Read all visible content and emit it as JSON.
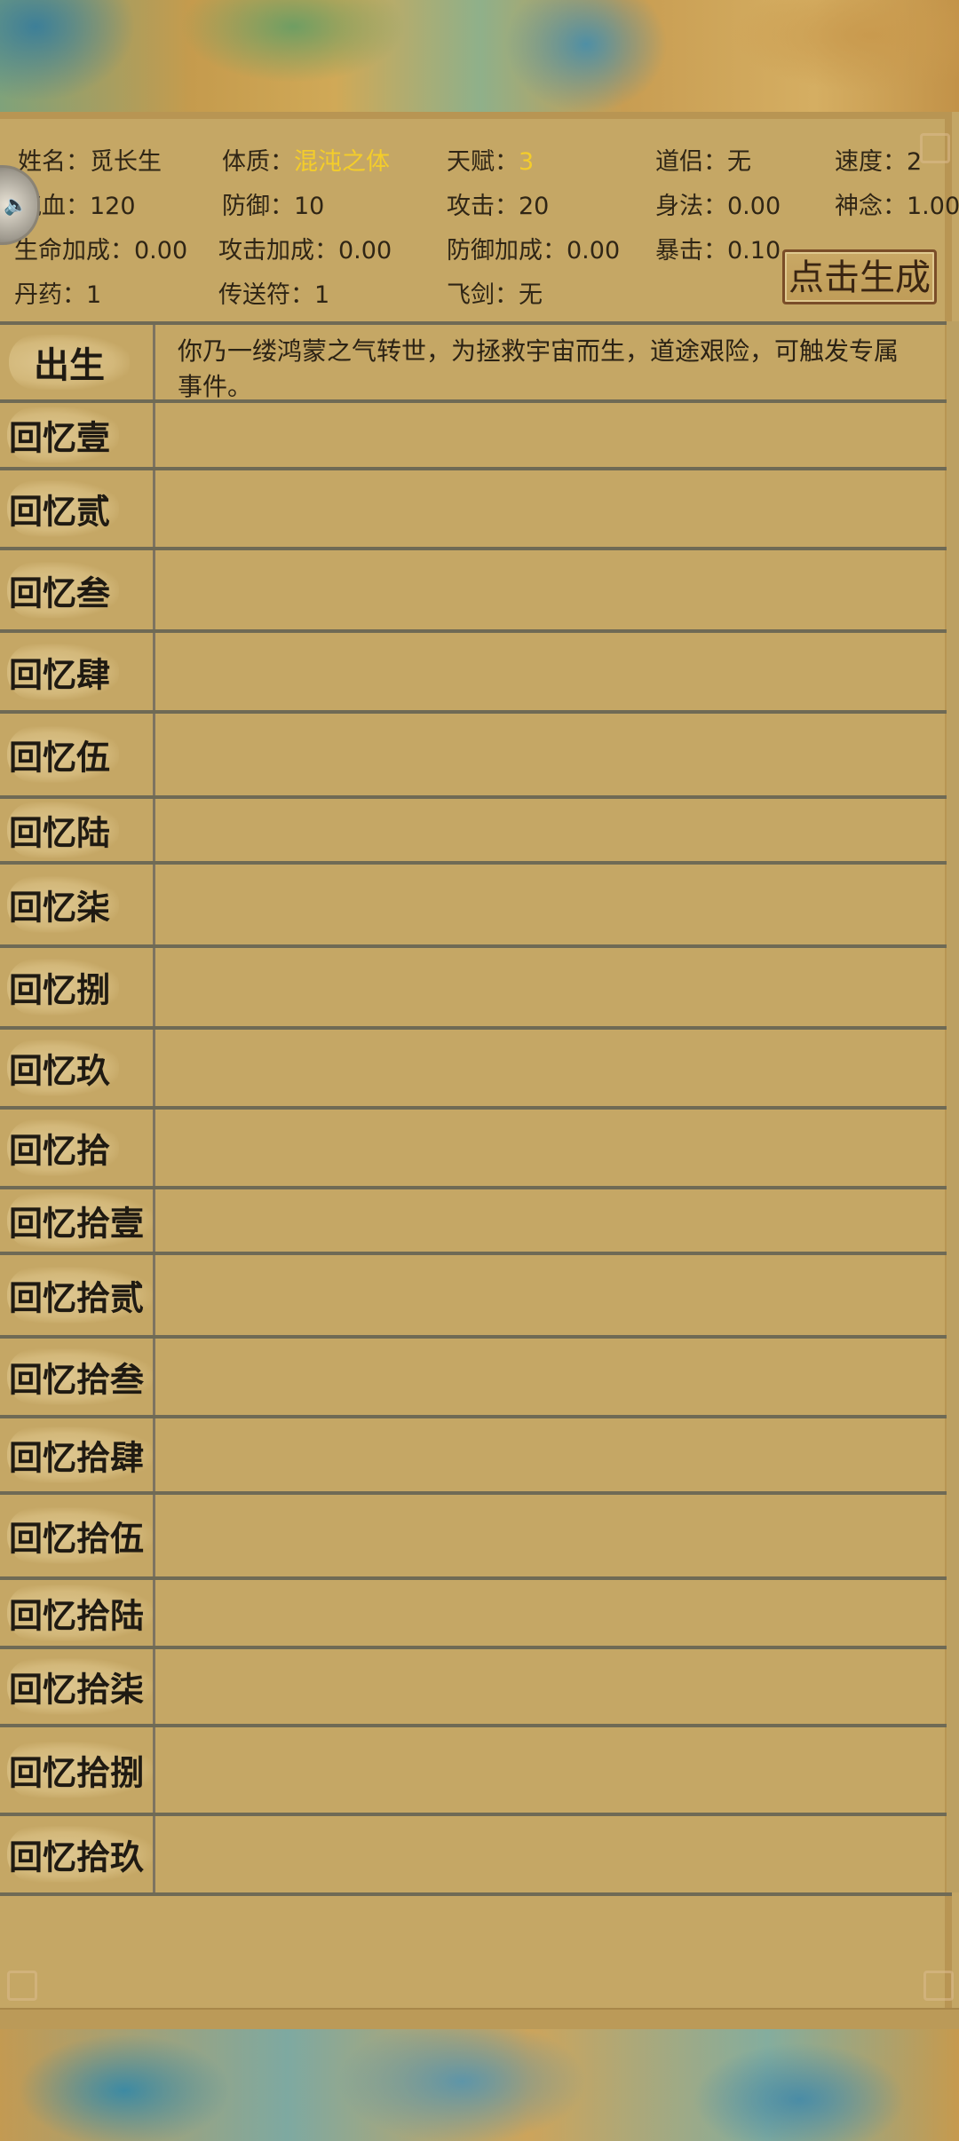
{
  "stats": {
    "name": {
      "k": "姓名：",
      "v": "觅长生"
    },
    "constitution": {
      "k": "体质：",
      "v": "混沌之体",
      "color": "#f4cd2a"
    },
    "talent": {
      "k": "天赋：",
      "v": "3",
      "color": "#f4cd2a"
    },
    "partner": {
      "k": "道侣：",
      "v": "无"
    },
    "speed": {
      "k": "速度：",
      "v": "2"
    },
    "hp": {
      "k": "气血：",
      "v": "120"
    },
    "defense": {
      "k": "防御：",
      "v": "10"
    },
    "attack": {
      "k": "攻击：",
      "v": "20"
    },
    "agility": {
      "k": "身法：",
      "v": "0.00"
    },
    "spirit": {
      "k": "神念：",
      "v": "1.00"
    },
    "life_bonus": {
      "k": "生命加成：",
      "v": "0.00"
    },
    "attack_bonus": {
      "k": "攻击加成：",
      "v": "0.00"
    },
    "defense_bonus": {
      "k": "防御加成：",
      "v": "0.00"
    },
    "crit": {
      "k": "暴击：",
      "v": "0.10"
    },
    "pills": {
      "k": "丹药：",
      "v": "1"
    },
    "teleport": {
      "k": "传送符：",
      "v": "1"
    },
    "sword": {
      "k": "飞剑：",
      "v": "无"
    }
  },
  "generate_button": "点击生成",
  "birth": {
    "label": "出生",
    "desc": "你乃一缕鸿蒙之气转世，为拯救宇宙而生，道途艰险，可触发专属事件。"
  },
  "memories": [
    "回忆壹",
    "回忆贰",
    "回忆叁",
    "回忆肆",
    "回忆伍",
    "回忆陆",
    "回忆柒",
    "回忆捌",
    "回忆玖",
    "回忆拾",
    "回忆拾壹",
    "回忆拾贰",
    "回忆拾叁",
    "回忆拾肆",
    "回忆拾伍",
    "回忆拾陆",
    "回忆拾柒",
    "回忆拾捌",
    "回忆拾玖"
  ],
  "icons": {
    "sound": "speaker-icon"
  }
}
